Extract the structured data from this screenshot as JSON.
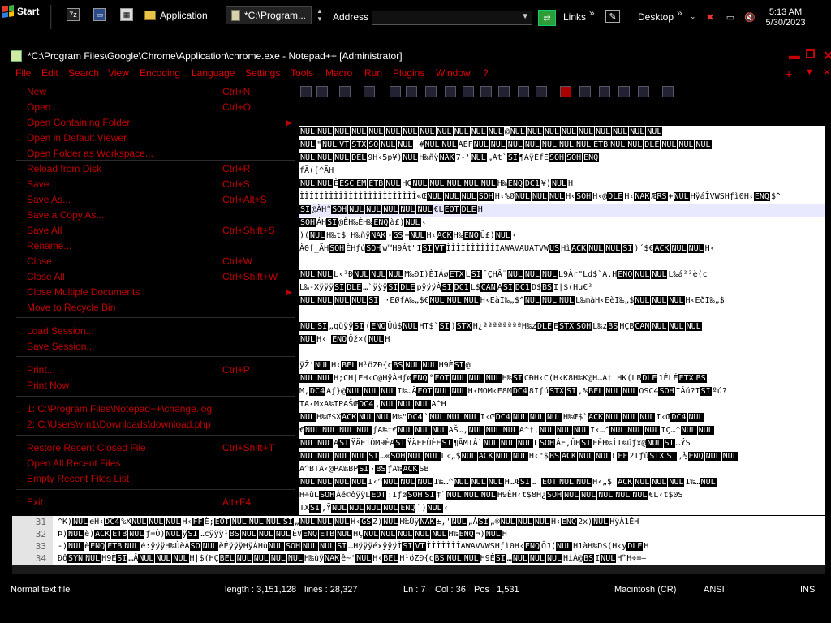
{
  "taskbar": {
    "start_label": "Start",
    "tasks": [
      {
        "label": "Application",
        "icon": "folder-icon"
      },
      {
        "label": "*C:\\Program...",
        "icon": "notepad-icon"
      }
    ],
    "address_label": "Address",
    "links_label": "Links",
    "desktop_label": "Desktop",
    "clock_time": "5:13 AM",
    "clock_date": "5/30/2023"
  },
  "window": {
    "title": "*C:\\Program Files\\Google\\Chrome\\Application\\chrome.exe - Notepad++ [Administrator]"
  },
  "menubar": {
    "items": [
      "File",
      "Edit",
      "Search",
      "View",
      "Encoding",
      "Language",
      "Settings",
      "Tools",
      "Macro",
      "Run",
      "Plugins",
      "Window",
      "?"
    ]
  },
  "file_menu": {
    "items": [
      {
        "label": "New",
        "shortcut": "Ctrl+N"
      },
      {
        "label": "Open...",
        "shortcut": "Ctrl+O"
      },
      {
        "label": "Open Containing Folder",
        "shortcut": ""
      },
      {
        "label": "Open in Default Viewer",
        "shortcut": ""
      },
      {
        "label": "Open Folder as Workspace...",
        "shortcut": ""
      },
      {
        "label": "Reload from Disk",
        "shortcut": "Ctrl+R"
      },
      {
        "label": "Save",
        "shortcut": "Ctrl+S"
      },
      {
        "label": "Save As...",
        "shortcut": "Ctrl+Alt+S"
      },
      {
        "label": "Save a Copy As...",
        "shortcut": ""
      },
      {
        "label": "Save All",
        "shortcut": "Ctrl+Shift+S"
      },
      {
        "label": "Rename...",
        "shortcut": ""
      },
      {
        "label": "Close",
        "shortcut": "Ctrl+W"
      },
      {
        "label": "Close All",
        "shortcut": "Ctrl+Shift+W"
      },
      {
        "label": "Close Multiple Documents",
        "shortcut": ""
      },
      {
        "label": "Move to Recycle Bin",
        "shortcut": ""
      },
      {
        "label": "Load Session...",
        "shortcut": ""
      },
      {
        "label": "Save Session...",
        "shortcut": ""
      },
      {
        "label": "Print...",
        "shortcut": "Ctrl+P"
      },
      {
        "label": "Print Now",
        "shortcut": ""
      },
      {
        "label": "1: C:\\Program Files\\Notepad++\\change.log",
        "shortcut": ""
      },
      {
        "label": "2: C:\\Users\\vm1\\Downloads\\download.php",
        "shortcut": ""
      },
      {
        "label": "Restore Recent Closed File",
        "shortcut": "Ctrl+Shift+T"
      },
      {
        "label": "Open All Recent Files",
        "shortcut": ""
      },
      {
        "label": "Empty Recent Files List",
        "shortcut": ""
      },
      {
        "label": "Exit",
        "shortcut": "Alt+F4"
      }
    ]
  },
  "editor": {
    "lines": [
      "NULNULNULNULNULNULNULNULNULNULNULNUL@NULNULNULNULNULNULNULNULNUL",
      "NUL\"NULVTSTXSONULNUL #NULNULÀÈFNULNULNULNULNULNULNULETBNULNULDLENULNULNUL",
      "NULNULNULDEL9H‹5p¥)NULH‰ñÿNAK7-'NUL„Àt`SI¶ÄÿÈfÈSOHSOHENQ",
      "fÄ([^ÃH",
      "NULNULÈESCEMETBNULHÇNULNULNULNULNULH‰ENQDC1¥)NULH",
      "ÌÌÌÌÌÌÌÌÌÌÌÌÌÌÌÌÌÌÌÌÌÌÌÌ«ŒNULNULNULSOHH‹%ØNULNULNULH‹SOHH‹@DLEH‹NAKÆRS+NULHÿáÎVWSHƒì0H‹ENQ$^",
      "SI@ÀH°SOHNULNULNULNULNUL€LEOTDLEH",
      "SOHÁHSI@ÈH‰ÈH‰ENQà£)NUL‹",
      ")(NULH‰t$ H‰ñÿNAK-GS+NULH‹ACKH‰ENQÛ£)NUL‹",
      "À0[_ÃHSOHÈHƒúSOHw™H9Át\"ISIVTÌÌÌÌÌÌÌÌÌÌÌAWAVAUATVWUSHìACKNULNULSI)´$€ACKNULNULH‹",
      "",
      "NULNULL‹²ÐNULNULNULM‰ÐI)ÈIÁøETXLSI¯ÇHÂ¨NULNULNULL9Àr\"Ld$`A,HENQNULNULL‰á²²è(c",
      "L‰-XÿÿÿSIDLE…`ÿÿÿSIDLEpÿÿÿÀSIDC1L$CANASIDC1D$BSI|$(Hu€²",
      "NULNULNULNULSI ·EØfA‰„$€NULNULNULH‹EàI‰„$^NULNULNULL‰màH‹EèI‰„$NULNULNULH‹EðI‰„$",
      "",
      "NULSI„qüÿÿSI(ENQÛü$NULHT$`SI)STXH¿ªªªªªªªªH‰zDLEESTXSOHL‰zBSHÇBCANNULNULNUL",
      "NULH‹ ENQÔž×(NULH",
      "",
      "ÿŽ'NULH‹BELH¹öZÐ{cBSNULNULH9ÈSI@",
      "NULNULH;CH|EH‹C@HÿÀHƒøENQ°EOTNULNULNULH‰SICÐH‹C(H‹K8H‰K@H…At HK(LBDLE1ÉLÉETXBS",
      "M,DC4Aƒ}@NULNULNULI‰…ÃEOTNULNULH‹MOM‹E8MDC48IƒúSTXSI,%BELNULNULOSC4SOHIÁú?ISIºú?",
      "TA‹MxA‰IPAŠŒDC4,NULNULNULA^H",
      "NULH‰Œ$XACKNULNULM‰\"DC4`NULNULNULI‹ŒDC4NULNULNULH‰Œ$`ACKNULNULNULI‹ŒDC4NUL",
      "€NULNULNULNULƒA‰†€NULNULNULAŠ…,NULNULNULA^†,NULNULNULI‹…^NULNULNULIÇ…^NULNUL",
      "NULNULASIŸÄE1ÒM9ÈASIŸÄEEÙÈESI¶ÃMIÀ`NULNULNULLSOHÁE,ÛHSIEÈH‰ÍI‰úƒx@NULSI…ŸS",
      "NULNULNULNULSI…«SOHNULNULL‹„$NULACKNULNULH‹\"$BSACKNULNULLFF2IƒûSTXSI,½ENQNULNUL",
      "A^BTA‹@PA‰BPSI·BSƒA‰ACKSB",
      "NULNULNULNULI‹^NULNULNULI‰…^NULNULNULH…ÆSI… EOTNULNULH‹„$`ACKNULNULNULI‰…NUL",
      "H÷ùLSOHÀé©ôÿÿLEOT:IƒøSOHSI‡`NULNULNULH9ÊH‹t$8H¿SOHNULNULNULNULNUL€L‹t$0S",
      "TXSI,ŸNULNULNULNULENQ`)NUL‹"
    ]
  },
  "bottom_editor": {
    "lines": [
      {
        "num": "31",
        "text": "^K)NULeH‹DC4%XNULNULNULH‹FFÈ;EOTNULNULNULSI„NULNULNULH‹GSZ)NULH‰ÙÿNAK±,'NUL„ÀSI„®NULNULNULH‹ENQ2x)NULHÿÀ1ÉH"
      },
      {
        "num": "32",
        "text": "Þ)NULè)ACKETBNULƒ=Ò)NULÿSI…cÿÿÿ¹BSNULNULNULÈVENQETBNULHÇNULNULNULNULNULH‰ENQ¬)NULH"
      },
      {
        "num": "33",
        "text": "-)NULèENQETBNULé:ÿÿÿH‰ÙèÀSONULèÉÿÿÿHÿÁHùNULSOHNULNULSI…HÿÿÿéxÿÿÿÌSIVTÌÌÌÌÌÌÌAWAVVWSHƒì0H‹ENQÔJ(NULH1àH‰D$(H‹yDLEH"
      },
      {
        "num": "34",
        "text": "ÐôSYNNULH9ÈSI…ÂNULNULNULH|$(HÇBELNULNULNULNULH‰ùÿNAKê~'NULH‹BELH¹öZÐ{cBSNULNULH9ÈSI…NULNULNULHiÀ@BSINULH™H÷=—"
      }
    ]
  },
  "statusbar": {
    "file_type": "Normal text file",
    "length": "length : 3,151,128",
    "lines": "lines : 28,327",
    "ln": "Ln : 7",
    "col": "Col : 36",
    "pos": "Pos : 1,531",
    "eol": "Macintosh (CR)",
    "encoding": "ANSI",
    "mode": "INS"
  }
}
